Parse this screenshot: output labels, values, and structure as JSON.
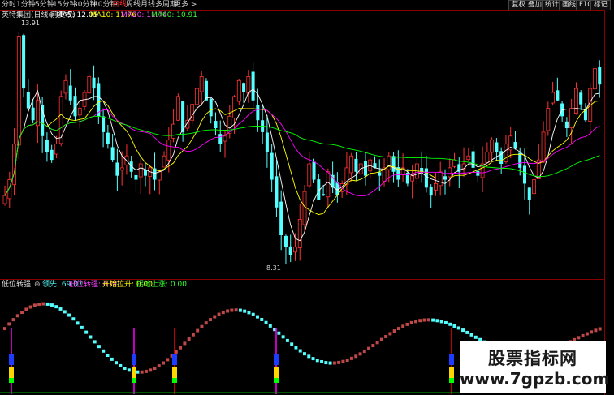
{
  "toolbar": {
    "tabs": [
      "分时",
      "1分钟",
      "5分钟",
      "15分钟",
      "30分钟",
      "60分钟",
      "日线",
      "周线",
      "月线",
      "多周期",
      "更多 >"
    ],
    "active_index": 6,
    "right_buttons": [
      "复权",
      "叠加",
      "统计",
      "画线",
      "F10",
      "标记"
    ]
  },
  "main_info": {
    "stock": "英特集团(日线 前复权)",
    "ma5": "MA5: 12.05",
    "ma10_label": "MA10: 11.76",
    "ma20": "MA20: 11.74",
    "ma60": "MA60: 10.91"
  },
  "price_marks": {
    "high": "13.91",
    "low": "8.31"
  },
  "indicator_info": {
    "name": "低位转强",
    "lead": "领先: 69.07",
    "low_turn": "低位转强: 0.00",
    "start_up": "开始拉升: 0.00",
    "lift": "拐地上涨: 0.00"
  },
  "watermark": {
    "line1": "股票指标网",
    "line2": "www.7gpzb.com"
  },
  "colors": {
    "up": "#ff3333",
    "down": "#54ffff",
    "ma5": "#ffffff",
    "ma10": "#ffff00",
    "ma20": "#ff00ff",
    "ma60": "#00ff00",
    "accent_red": "#ff3030"
  },
  "chart_data": {
    "type": "candlestick",
    "candles_close_approx": [
      9.9,
      10.3,
      11.2,
      13.9,
      12.6,
      12.1,
      11.8,
      12.3,
      11.4,
      11.0,
      10.8,
      11.2,
      12.4,
      12.8,
      12.3,
      11.9,
      12.1,
      12.5,
      12.9,
      12.6,
      11.9,
      11.5,
      11.2,
      10.8,
      10.4,
      10.6,
      10.9,
      10.5,
      10.3,
      10.7,
      10.4,
      10.6,
      10.3,
      10.5,
      10.9,
      11.3,
      11.7,
      12.4,
      11.5,
      11.8,
      12.2,
      12.6,
      12.9,
      12.3,
      11.9,
      11.6,
      11.2,
      11.4,
      11.9,
      12.4,
      12.8,
      12.5,
      12.9,
      12.3,
      11.8,
      11.5,
      11.0,
      10.3,
      9.6,
      8.9,
      8.6,
      8.4,
      8.6,
      9.3,
      10.0,
      10.7,
      10.3,
      9.8,
      9.9,
      10.5,
      10.1,
      9.9,
      10.2,
      10.6,
      10.9,
      10.5,
      10.7,
      10.4,
      10.8,
      10.6,
      10.4,
      10.6,
      10.9,
      10.5,
      10.3,
      10.6,
      10.2,
      10.4,
      10.7,
      10.5,
      10.1,
      9.9,
      10.2,
      10.5,
      10.3,
      10.6,
      10.8,
      10.5,
      10.7,
      10.9,
      10.6,
      10.4,
      10.7,
      11.0,
      11.3,
      11.0,
      10.7,
      11.2,
      11.4,
      11.1,
      10.6,
      10.2,
      9.8,
      10.3,
      10.8,
      11.5,
      12.1,
      12.5,
      12.3,
      11.9,
      11.6,
      12.1,
      12.6,
      12.2,
      11.8,
      12.6,
      13.1,
      12.7
    ]
  }
}
